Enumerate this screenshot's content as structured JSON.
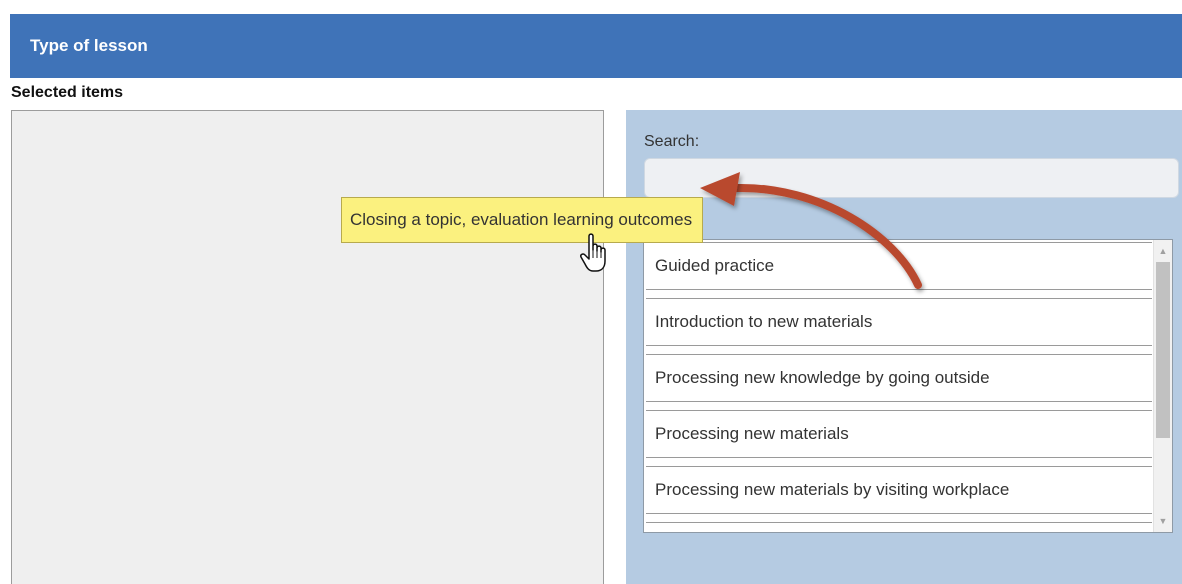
{
  "header": {
    "title": "Type of lesson"
  },
  "selected": {
    "label": "Selected items"
  },
  "search": {
    "label": "Search:",
    "value": ""
  },
  "list": {
    "items": [
      "Guided practice",
      "Introduction to new materials",
      "Processing new knowledge by going outside",
      "Processing new materials",
      "Processing new materials by visiting workplace"
    ]
  },
  "tooltip": {
    "text": "Closing a topic, evaluation learning outcomes"
  },
  "colors": {
    "header_bg": "#3f73b8",
    "panel_bg": "#b5cbe2",
    "tooltip_bg": "#fbf17f",
    "arrow": "#b9482f"
  },
  "icons": {
    "cursor": "hand-pointer-icon",
    "annotation": "curved-arrow-icon",
    "scroll_up": "scroll-up-icon",
    "scroll_down": "scroll-down-icon"
  }
}
